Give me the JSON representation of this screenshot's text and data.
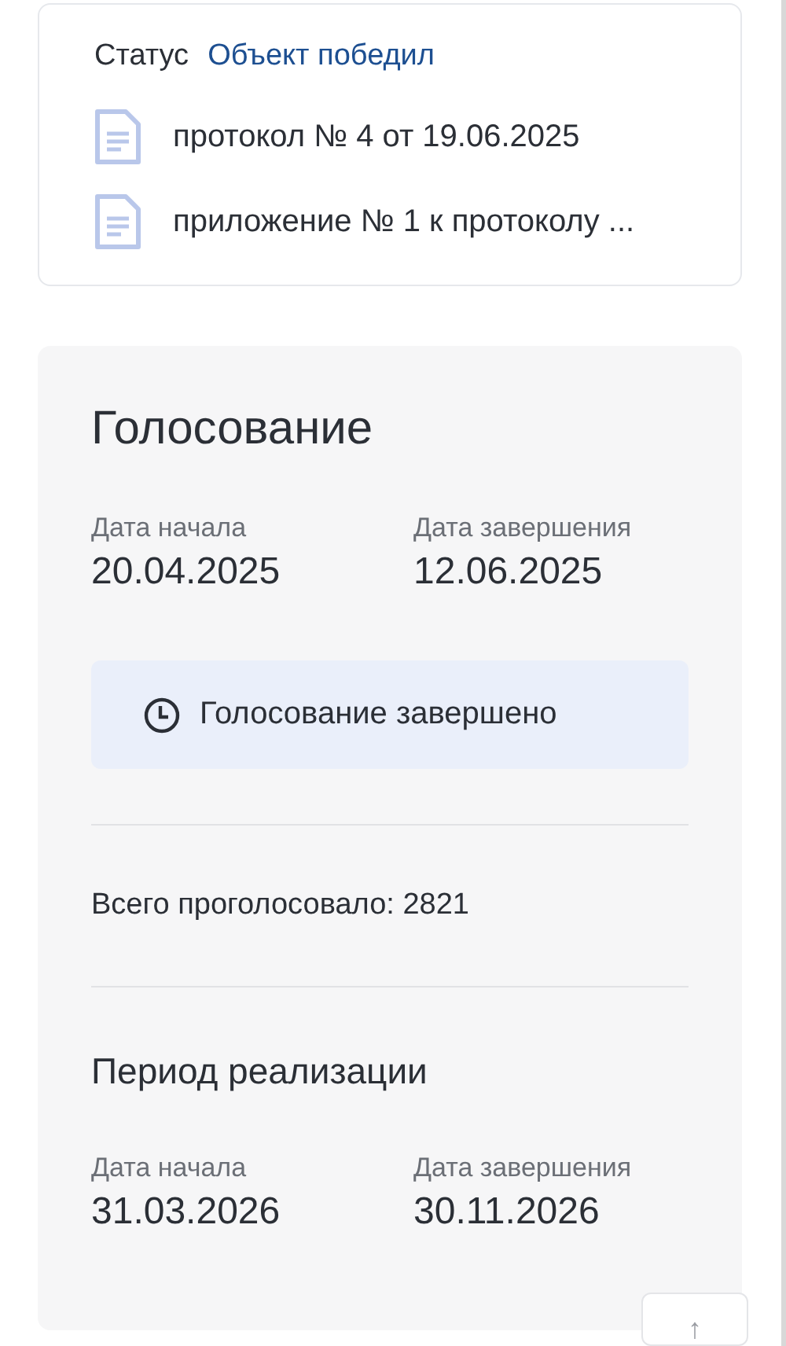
{
  "status": {
    "label": "Статус",
    "value": "Объект победил"
  },
  "documents": [
    {
      "title": "протокол № 4 от 19.06.2025"
    },
    {
      "title": "приложение № 1 к протоколу ..."
    }
  ],
  "voting": {
    "title": "Голосование",
    "dates": [
      {
        "label": "Дата начала",
        "value": "20.04.2025"
      },
      {
        "label": "Дата завершения",
        "value": "12.06.2025"
      }
    ],
    "notice": "Голосование завершено",
    "total": "Всего проголосовало: 2821"
  },
  "implementation": {
    "title": "Период реализации",
    "dates": [
      {
        "label": "Дата начала",
        "value": "31.03.2026"
      },
      {
        "label": "Дата завершения",
        "value": "30.11.2026"
      }
    ]
  },
  "scroll_top": {
    "symbol": "↑"
  }
}
